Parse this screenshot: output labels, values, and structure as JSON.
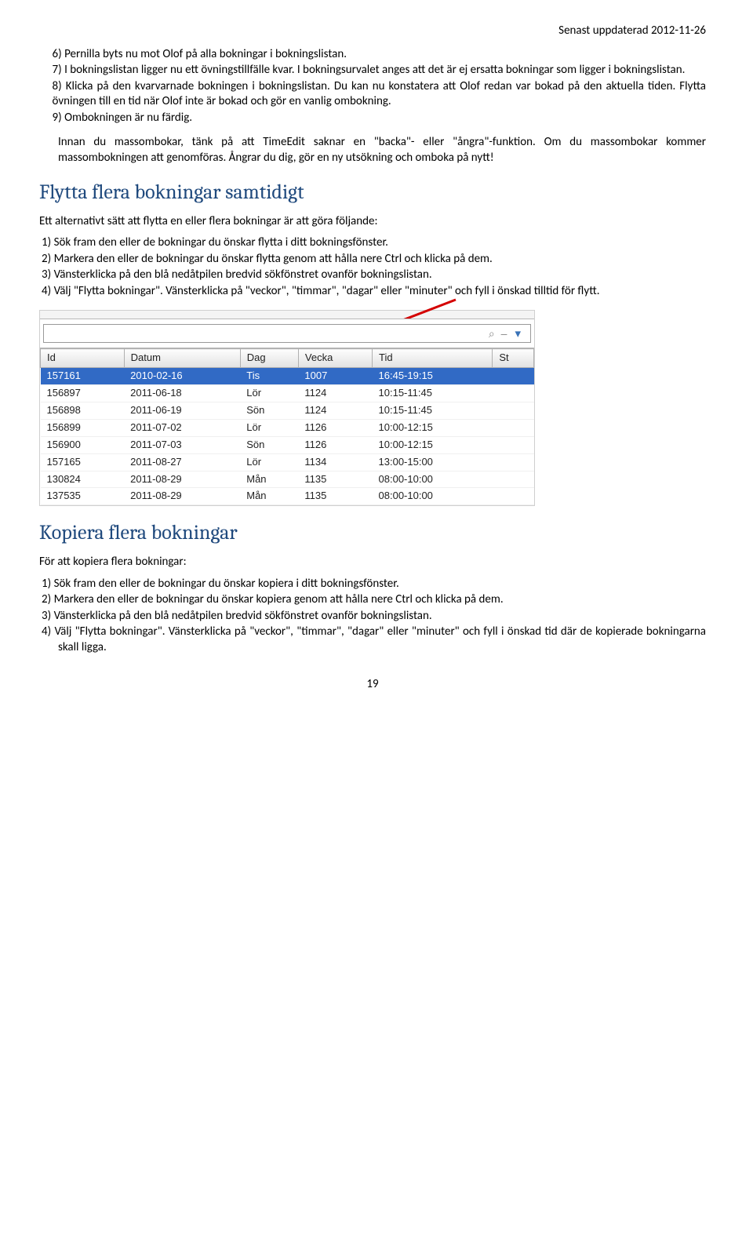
{
  "header": {
    "updated": "Senast uppdaterad 2012-11-26"
  },
  "list_a": {
    "items": [
      "Pernilla byts nu mot Olof på alla bokningar i bokningslistan.",
      "I bokningslistan ligger nu ett övningstillfälle kvar. I bokningsurvalet anges att det är ej ersatta bokningar som ligger i bokningslistan.",
      "Klicka på den kvarvarnade bokningen i bokningslistan. Du kan nu konstatera att Olof redan var bokad på den aktuella tiden. Flytta övningen till en tid när Olof inte är bokad och gör en vanlig ombokning.",
      "Ombokningen är nu färdig."
    ]
  },
  "note": "Innan du massombokar, tänk på att TimeEdit saknar en \"backa\"- eller \"ångra\"-funktion. Om du massombokar kommer massombokningen att genomföras. Ångrar du dig, gör en ny utsökning och omboka på nytt!",
  "section_flytta": {
    "heading": "Flytta flera bokningar samtidigt",
    "intro": "Ett alternativt sätt att flytta en eller flera bokningar är att göra följande:",
    "steps": [
      "Sök fram den eller de bokningar du önskar flytta i ditt bokningsfönster.",
      "Markera den eller de bokningar du önskar flytta genom att hålla nere Ctrl och klicka på dem.",
      "Vänsterklicka på den blå nedåtpilen bredvid sökfönstret ovanför bokningslistan.",
      "Välj \"Flytta bokningar\". Vänsterklicka på \"veckor\", \"timmar\", \"dagar\" eller \"minuter\" och fyll i önskad tilltid för flytt."
    ]
  },
  "widget": {
    "columns": [
      "Id",
      "Datum",
      "Dag",
      "Vecka",
      "Tid",
      "St"
    ],
    "rows": [
      {
        "id": "157161",
        "datum": "2010-02-16",
        "dag": "Tis",
        "vecka": "1007",
        "tid": "16:45-19:15",
        "selected": true
      },
      {
        "id": "156897",
        "datum": "2011-06-18",
        "dag": "Lör",
        "vecka": "1124",
        "tid": "10:15-11:45"
      },
      {
        "id": "156898",
        "datum": "2011-06-19",
        "dag": "Sön",
        "vecka": "1124",
        "tid": "10:15-11:45"
      },
      {
        "id": "156899",
        "datum": "2011-07-02",
        "dag": "Lör",
        "vecka": "1126",
        "tid": "10:00-12:15"
      },
      {
        "id": "156900",
        "datum": "2011-07-03",
        "dag": "Sön",
        "vecka": "1126",
        "tid": "10:00-12:15"
      },
      {
        "id": "157165",
        "datum": "2011-08-27",
        "dag": "Lör",
        "vecka": "1134",
        "tid": "13:00-15:00"
      },
      {
        "id": "130824",
        "datum": "2011-08-29",
        "dag": "Mån",
        "vecka": "1135",
        "tid": "08:00-10:00"
      },
      {
        "id": "137535",
        "datum": "2011-08-29",
        "dag": "Mån",
        "vecka": "1135",
        "tid": "08:00-10:00"
      }
    ]
  },
  "section_kopiera": {
    "heading": "Kopiera flera bokningar",
    "intro": "För att kopiera flera bokningar:",
    "steps": [
      "Sök fram den eller de bokningar du önskar kopiera i ditt bokningsfönster.",
      "Markera den eller de bokningar du önskar kopiera genom att hålla nere Ctrl och klicka på dem.",
      "Vänsterklicka på den blå nedåtpilen bredvid sökfönstret ovanför bokningslistan.",
      "Välj \"Flytta bokningar\". Vänsterklicka på \"veckor\", \"timmar\", \"dagar\" eller \"minuter\" och fyll i önskad tid där de kopierade bokningarna skall ligga."
    ]
  },
  "page_number": "19"
}
